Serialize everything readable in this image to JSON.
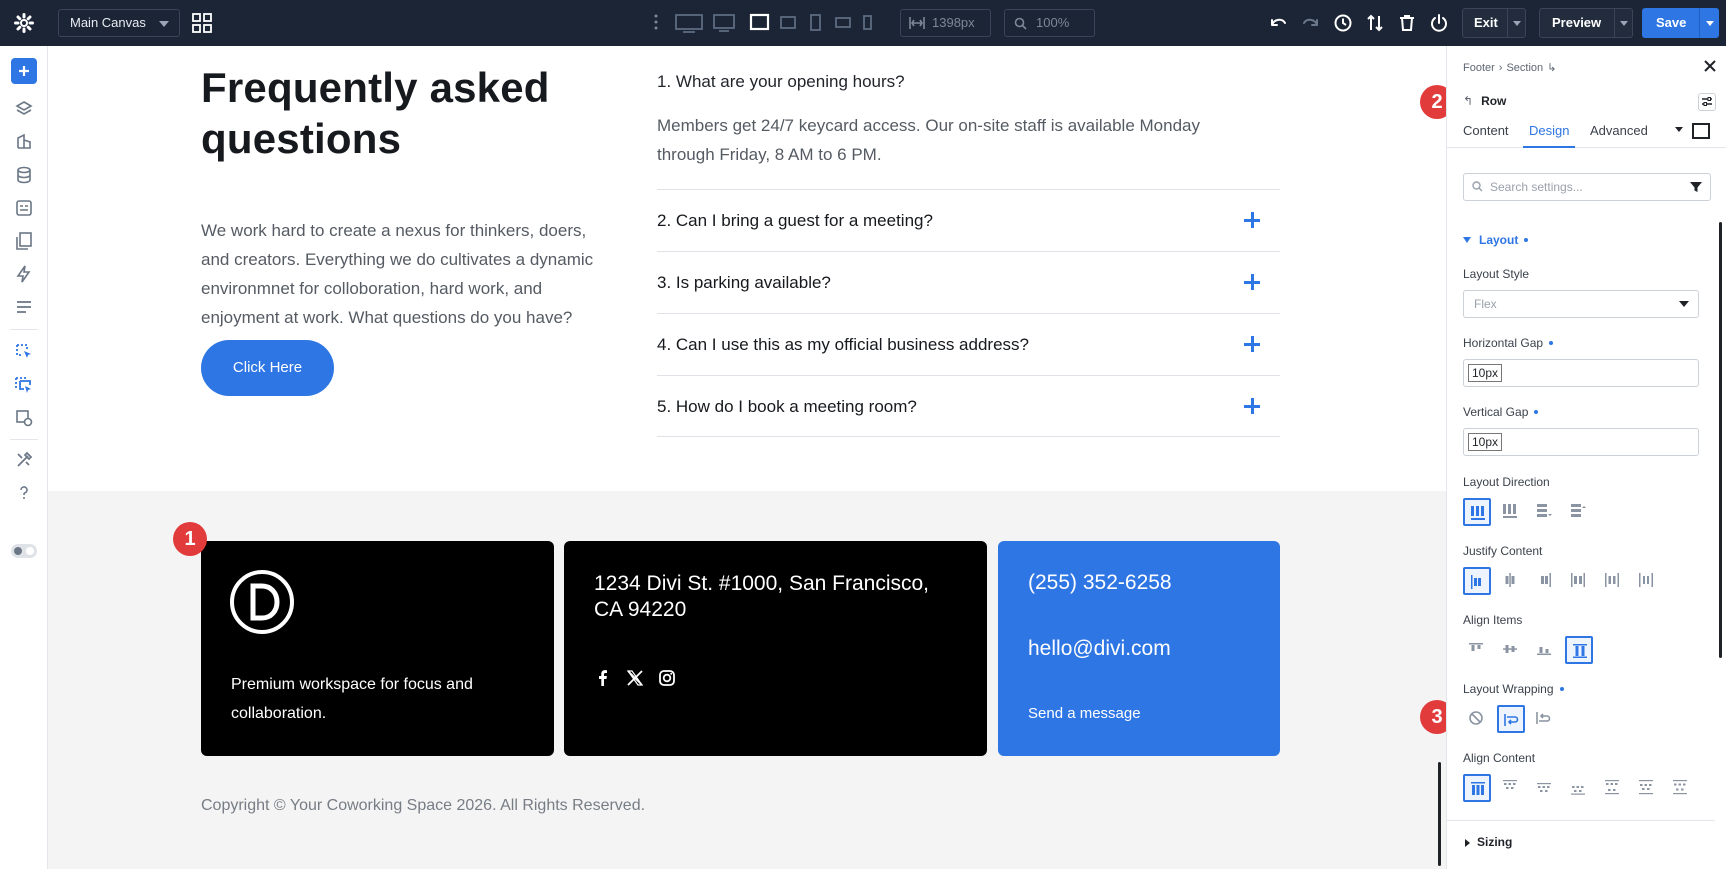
{
  "topbar": {
    "canvas_select": "Main Canvas",
    "width_value": "1398px",
    "zoom_value": "100%",
    "exit_label": "Exit",
    "preview_label": "Preview",
    "save_label": "Save"
  },
  "faq": {
    "title": "Frequently asked questions",
    "description": "We work hard to create a nexus for thinkers, doers, and creators. Everything we do cultivates a dynamic environmnet for colloboration, hard work, and enjoyment at work. What questions do you have?",
    "button_label": "Click Here",
    "open_question": "1. What are your opening hours?",
    "open_answer": "Members get 24/7 keycard access. Our on-site staff is available Monday through Friday, 8 AM to 6 PM.",
    "questions": [
      "2. Can I bring a guest for a meeting?",
      "3. Is parking available?",
      "4. Can I use this as my official business address?",
      "5. How do I book a meeting room?"
    ]
  },
  "footer": {
    "card1_text": "Premium workspace for focus and collaboration.",
    "card2_address": "1234 Divi St. #1000, San Francisco, CA 94220",
    "card3_phone": "(255) 352-6258",
    "card3_email": "hello@divi.com",
    "card3_send": "Send a message",
    "copyright": "Copyright © Your Coworking Space 2026. All Rights Reserved."
  },
  "badges": [
    "1",
    "2",
    "3"
  ],
  "panel": {
    "breadcrumb": [
      "Footer",
      "›",
      "Section",
      "↳"
    ],
    "row_title": "Row",
    "tabs": [
      "Content",
      "Design",
      "Advanced"
    ],
    "active_tab": "Design",
    "search_placeholder": "Search settings...",
    "section_layout": "Layout",
    "layout_style_label": "Layout Style",
    "layout_style_value": "Flex",
    "horizontal_gap_label": "Horizontal Gap",
    "horizontal_gap_value": "10px",
    "vertical_gap_label": "Vertical Gap",
    "vertical_gap_value": "10px",
    "layout_direction_label": "Layout Direction",
    "justify_content_label": "Justify Content",
    "align_items_label": "Align Items",
    "layout_wrapping_label": "Layout Wrapping",
    "align_content_label": "Align Content",
    "section_sizing": "Sizing"
  },
  "colors": {
    "accent": "#2e76e4",
    "topbar": "#1b2535",
    "badge": "#e23b3b"
  }
}
